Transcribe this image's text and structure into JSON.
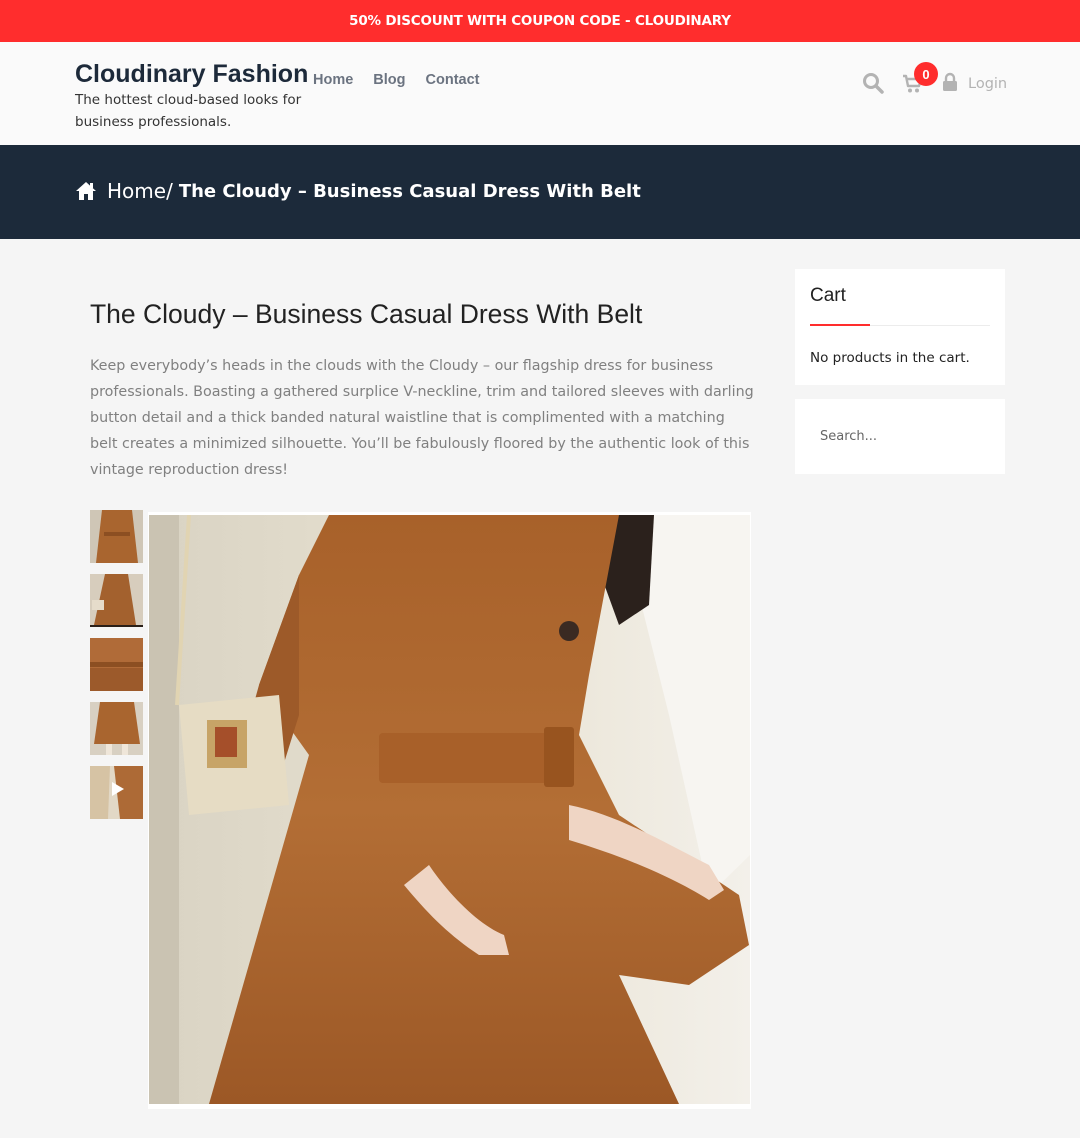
{
  "promo": {
    "text": "50% DISCOUNT WITH COUPON CODE - CLOUDINARY"
  },
  "header": {
    "brand_name": "Cloudinary Fashion",
    "tagline": "The hottest cloud-based looks for business professionals.",
    "nav": [
      "Home",
      "Blog",
      "Contact"
    ],
    "cart_count": "0",
    "login_label": "Login",
    "icons": [
      "search-icon",
      "cart-icon",
      "lock-icon"
    ]
  },
  "breadcrumb": {
    "home": "Home",
    "separator": "/",
    "current": "The Cloudy – Business Casual Dress With Belt",
    "icon": "home-icon"
  },
  "product": {
    "title": "The Cloudy – Business Casual Dress With Belt",
    "description": "Keep everybody’s heads in the clouds with the Cloudy – our flagship dress for business professionals. Boasting a gathered surplice V-neckline, trim and tailored sleeves with darling button detail and a thick banded natural waistline that is complimented with a matching belt creates a minimized silhouette. You’ll be fabulously floored by the authentic look of this vintage reproduction dress!",
    "thumbnails": [
      "image",
      "image",
      "image",
      "image",
      "video"
    ]
  },
  "sidebar": {
    "cart_title": "Cart",
    "cart_empty": "No products in the cart.",
    "search_placeholder": "Search..."
  },
  "colors": {
    "accent": "#ff2d2d",
    "navy": "#1c2a3a",
    "dress": "#b3703d"
  }
}
